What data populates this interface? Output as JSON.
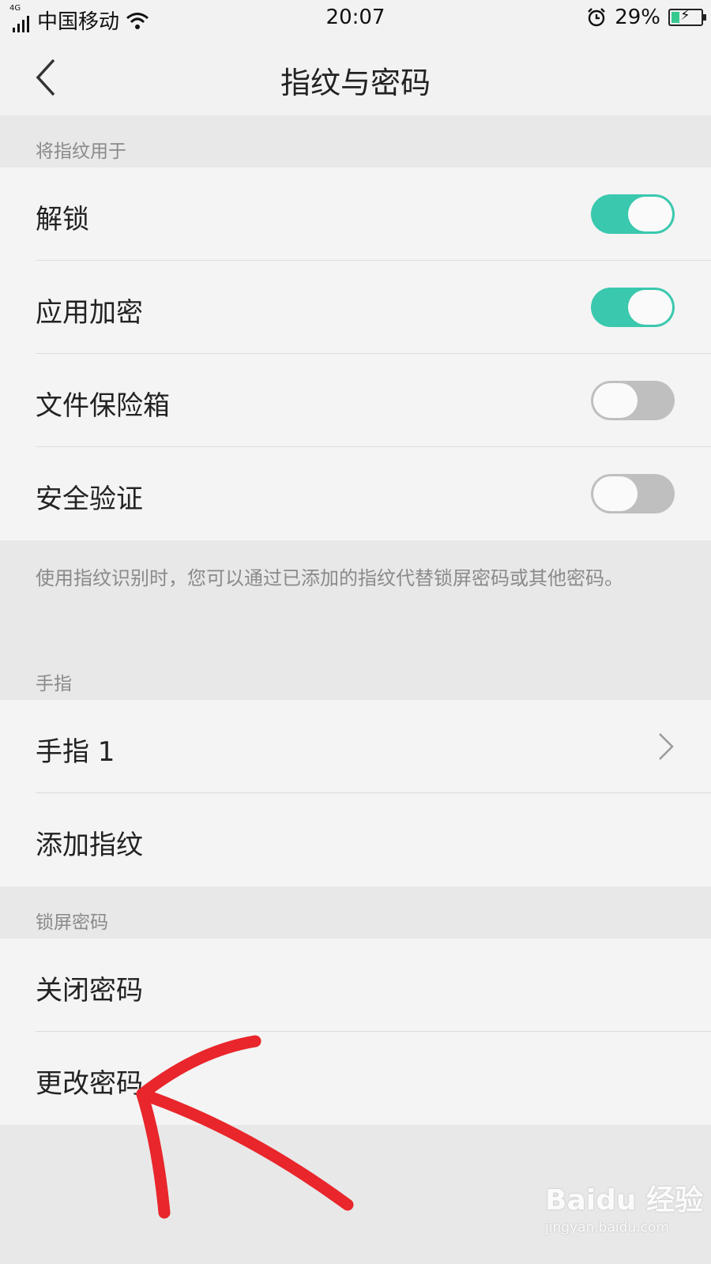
{
  "status_bar": {
    "network": "4G",
    "carrier": "中国移动",
    "time": "20:07",
    "battery": "29%",
    "icons": [
      "signal-icon",
      "wifi-icon",
      "alarm-icon",
      "battery-icon"
    ]
  },
  "header": {
    "title": "指纹与密码",
    "back_icon": "chevron-left-icon"
  },
  "fingerprint_usage": {
    "section_label": "将指纹用于",
    "items": [
      {
        "label": "解锁",
        "enabled": true
      },
      {
        "label": "应用加密",
        "enabled": true
      },
      {
        "label": "文件保险箱",
        "enabled": false
      },
      {
        "label": "安全验证",
        "enabled": false
      }
    ],
    "note": "使用指纹识别时，您可以通过已添加的指纹代替锁屏密码或其他密码。"
  },
  "fingers": {
    "section_label": "手指",
    "items": [
      {
        "label": "手指 1"
      },
      {
        "label": "添加指纹"
      }
    ]
  },
  "lock_password": {
    "section_label": "锁屏密码",
    "items": [
      {
        "label": "关闭密码"
      },
      {
        "label": "更改密码"
      }
    ]
  },
  "colors": {
    "toggle_on": "#3ac8ae",
    "toggle_off": "#bfbfbf",
    "annotation": "#e8262b"
  },
  "watermark": {
    "brand": "Baidu 经验",
    "url": "jingyan.baidu.com"
  }
}
